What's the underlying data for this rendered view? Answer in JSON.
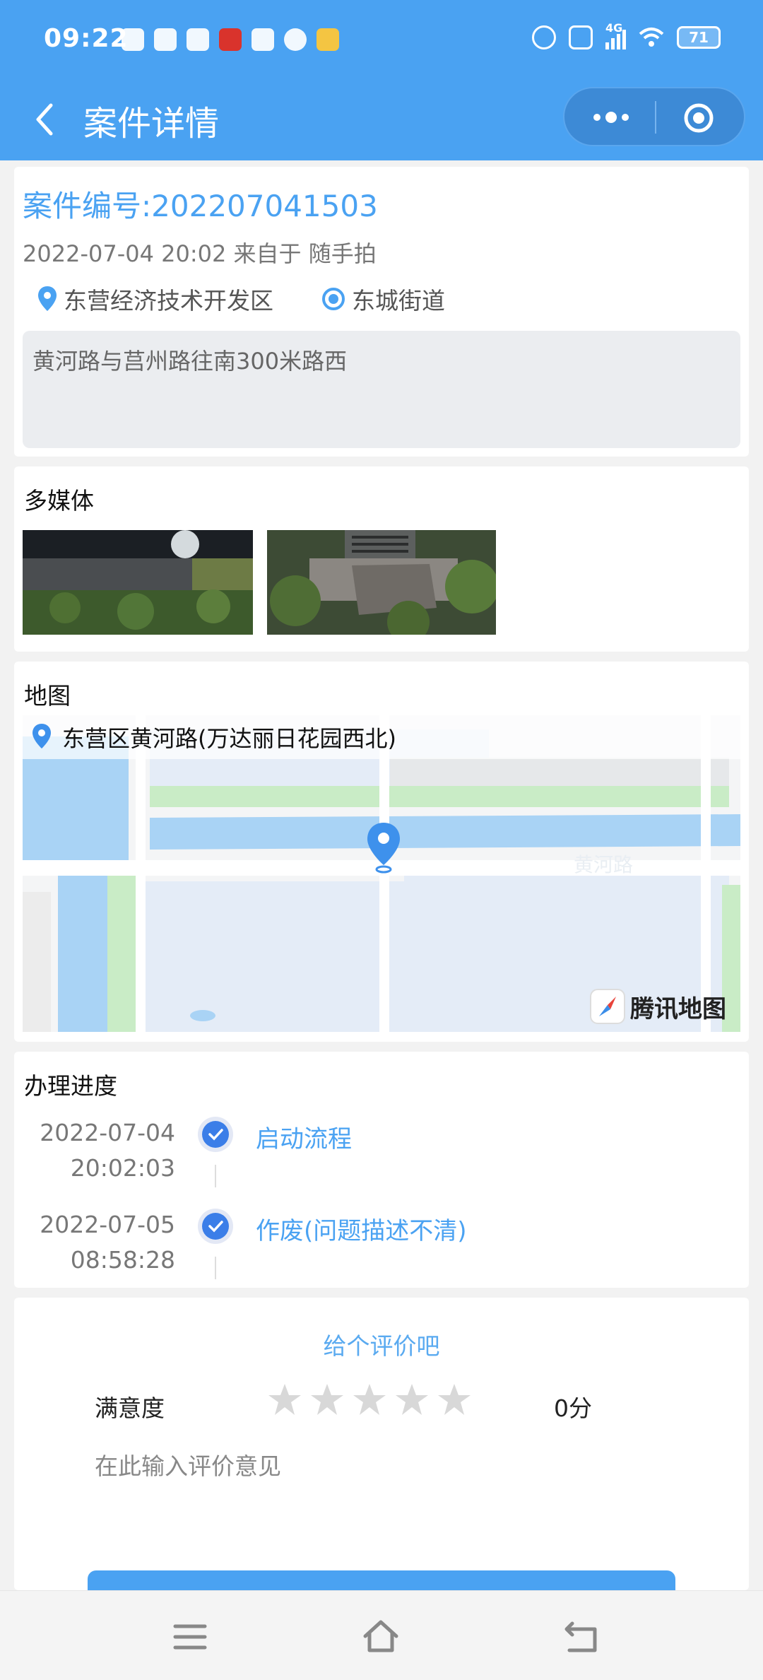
{
  "status_bar": {
    "time": "09:22",
    "network": "4G",
    "battery": "71",
    "notification_icons": [
      "wechat-icon",
      "qq-icon",
      "video-icon",
      "news-icon",
      "alipay-icon",
      "compass-icon",
      "weibo-icon"
    ],
    "system_icons": [
      "alarm-icon",
      "hd-icon",
      "signal-icon",
      "wifi-icon",
      "battery-icon"
    ]
  },
  "navbar": {
    "title": "案件详情",
    "back_icon": "chevron-left-icon",
    "more_icon": "more-dots-icon",
    "close_icon": "target-icon"
  },
  "case": {
    "number_label": "案件编号:202207041503",
    "meta": "2022-07-04 20:02 来自于 随手拍",
    "district": "东营经济技术开发区",
    "street": "东城街道",
    "description": "黄河路与莒州路往南300米路西"
  },
  "media": {
    "title": "多媒体"
  },
  "map": {
    "title": "地图",
    "address": "东营区黄河路(万达丽日花园西北)",
    "road_label": "黄河路",
    "brand": "腾讯地图"
  },
  "progress": {
    "title": "办理进度",
    "items": [
      {
        "date": "2022-07-04",
        "time": "20:02:03",
        "label": "启动流程"
      },
      {
        "date": "2022-07-05",
        "time": "08:58:28",
        "label": "作废(问题描述不清)"
      }
    ]
  },
  "rating": {
    "title": "给个评价吧",
    "satisfaction_label": "满意度",
    "stars_max": 5,
    "stars_value": 0,
    "score": "0分",
    "comment_placeholder": "在此输入评价意见"
  },
  "bottom_nav": [
    "menu-icon",
    "home-icon",
    "back-icon"
  ],
  "colors": {
    "accent": "#4aa2f2",
    "background": "#f2f2f2",
    "star_empty": "#d8d8d8"
  }
}
